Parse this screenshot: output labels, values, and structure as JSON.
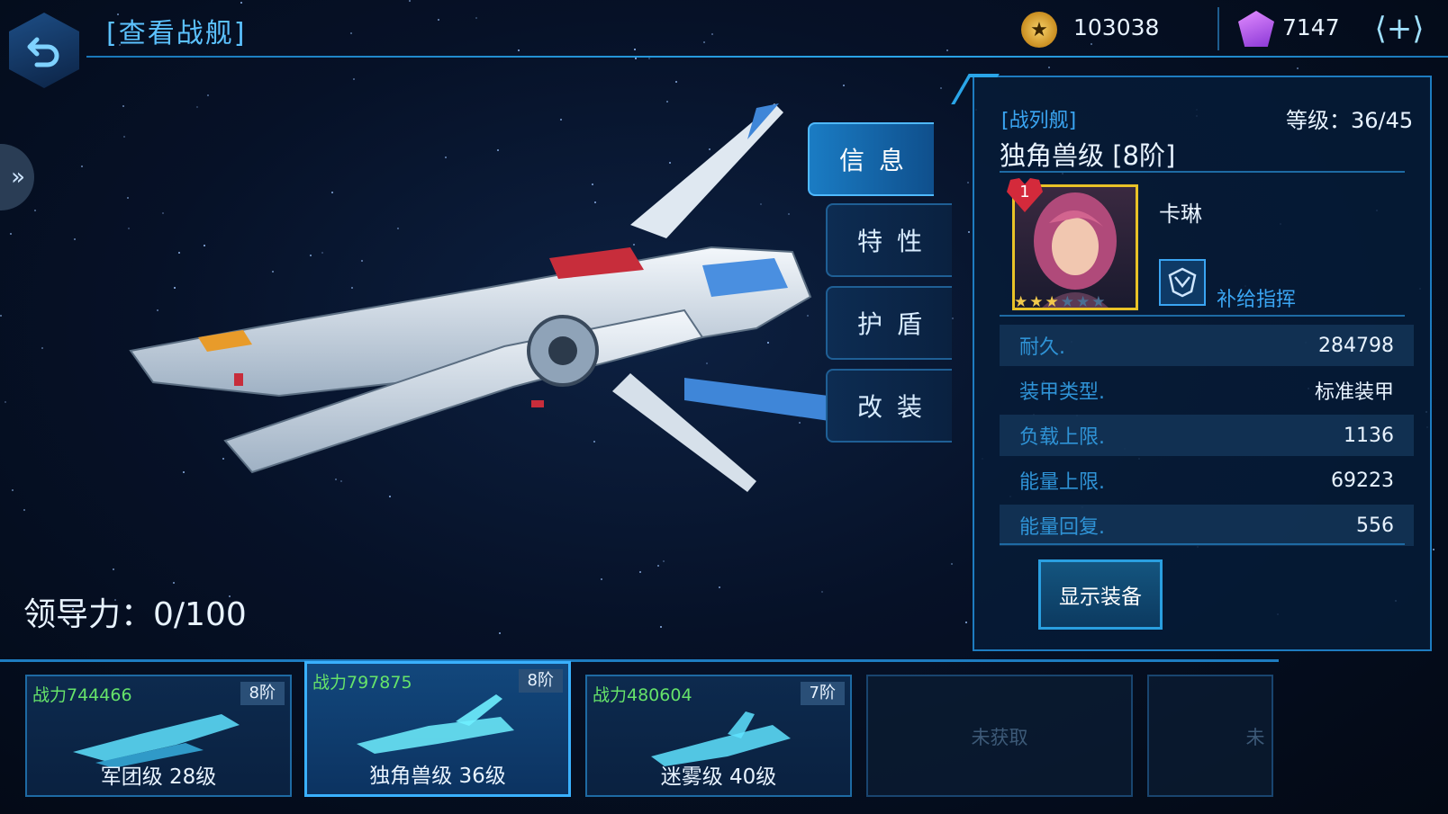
{
  "header": {
    "title": "[查看战舰]",
    "coins": "103038",
    "gems": "7147",
    "plus_label": "+"
  },
  "tabs": [
    {
      "label": "信息"
    },
    {
      "label": "特性"
    },
    {
      "label": "护盾"
    },
    {
      "label": "改装"
    }
  ],
  "info": {
    "type": "[战列舰]",
    "level": "等级：36/45",
    "ship_name": "独角兽级 [8阶]",
    "officer_badge": "1",
    "officer_name": "卡琳",
    "officer_stars": 3,
    "officer_stars_max": 6,
    "skill": "补给指挥",
    "stats": [
      {
        "label": "耐久.",
        "value": "284798"
      },
      {
        "label": "装甲类型.",
        "value": "标准装甲"
      },
      {
        "label": "负载上限.",
        "value": "1136"
      },
      {
        "label": "能量上限.",
        "value": "69223"
      },
      {
        "label": "能量回复.",
        "value": "556"
      }
    ],
    "show_equipment": "显示装备"
  },
  "leadership": "领导力：0/100",
  "roster": [
    {
      "power": "战力744466",
      "grade": "8阶",
      "name": "军团级 28级",
      "selected": false
    },
    {
      "power": "战力797875",
      "grade": "8阶",
      "name": "独角兽级 36级",
      "selected": true
    },
    {
      "power": "战力480604",
      "grade": "7阶",
      "name": "迷雾级 40级",
      "selected": false
    },
    {
      "empty_label": "未获取"
    },
    {
      "empty_label": "未"
    }
  ],
  "colors": {
    "accent": "#2aa5e8",
    "power_green": "#66e36a",
    "portrait_gold": "#e9c227",
    "heart_red": "#d42a3b"
  }
}
